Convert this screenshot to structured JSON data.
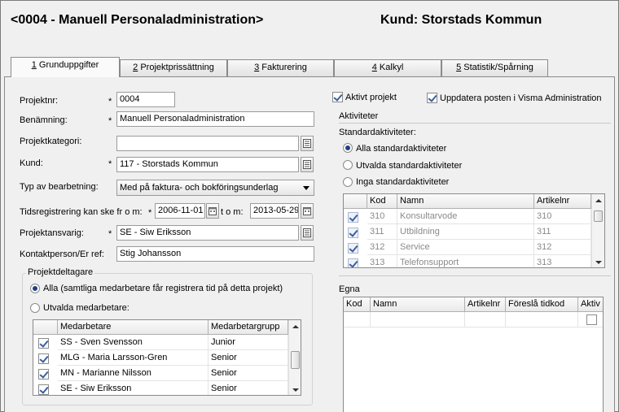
{
  "header": {
    "title": "<0004 - Manuell Personaladministration>",
    "customer": "Kund: Storstads Kommun"
  },
  "tabs": [
    {
      "num": "1",
      "label": " Grunduppgifter",
      "active": true
    },
    {
      "num": "2",
      "label": " Projektprissättning"
    },
    {
      "num": "3",
      "label": " Fakturering"
    },
    {
      "num": "4",
      "label": " Kalkyl"
    },
    {
      "num": "5",
      "label": " Statistik/Spårning"
    }
  ],
  "form": {
    "projektnr_label": "Projektnr:",
    "projektnr_value": "0004",
    "benamning_label": "Benämning:",
    "benamning_value": "Manuell Personaladministration",
    "projektkategori_label": "Projektkategori:",
    "projektkategori_value": "",
    "kund_label": "Kund:",
    "kund_value": "117 - Storstads Kommun",
    "typ_label": "Typ av bearbetning:",
    "typ_value": "Med på faktura- och bokföringsunderlag",
    "tidsreg_label": "Tidsregistrering kan ske fr o m:",
    "from_date": "2006-11-01",
    "tom_label": "t o m:",
    "to_date": "2013-05-29",
    "ansvarig_label": "Projektansvarig:",
    "ansvarig_value": "SE - Siw Eriksson",
    "kontakt_label": "Kontaktperson/Er ref:",
    "kontakt_value": "Stig Johansson",
    "required_mark": "*"
  },
  "projektdeltagare": {
    "title": "Projektdeltagare",
    "option_all": "Alla (samtliga medarbetare får registrera tid på detta projekt)",
    "option_selected": "Utvalda medarbetare:",
    "columns": [
      "Medarbetare",
      "Medarbetargrupp"
    ],
    "rows": [
      {
        "name": "SS - Sven Svensson",
        "group": "Junior",
        "checked": true
      },
      {
        "name": "MLG - Maria Larsson-Gren",
        "group": "Senior",
        "checked": true
      },
      {
        "name": "MN - Marianne Nilsson",
        "group": "Senior",
        "checked": true
      },
      {
        "name": "SE - Siw Eriksson",
        "group": "Senior",
        "checked": true
      }
    ]
  },
  "right": {
    "aktivt_projekt": "Aktivt projekt",
    "uppdatera": "Uppdatera posten i Visma Administration",
    "aktiviteter_title": "Aktiviteter",
    "standard_label": "Standardaktiviteter:",
    "opt_alla": "Alla standardaktiviteter",
    "opt_utvalda": "Utvalda standardaktiviteter",
    "opt_inga": "Inga standardaktiviteter",
    "std_columns": [
      "Kod",
      "Namn",
      "Artikelnr"
    ],
    "std_rows": [
      {
        "kod": "310",
        "namn": "Konsultarvode",
        "art": "310"
      },
      {
        "kod": "311",
        "namn": "Utbildning",
        "art": "311"
      },
      {
        "kod": "312",
        "namn": "Service",
        "art": "312"
      },
      {
        "kod": "313",
        "namn": "Telefonsupport",
        "art": "313"
      }
    ],
    "egna_label": "Egna",
    "egna_columns": [
      "Kod",
      "Namn",
      "Artikelnr",
      "Föreslå tidkod",
      "Aktiv"
    ]
  }
}
